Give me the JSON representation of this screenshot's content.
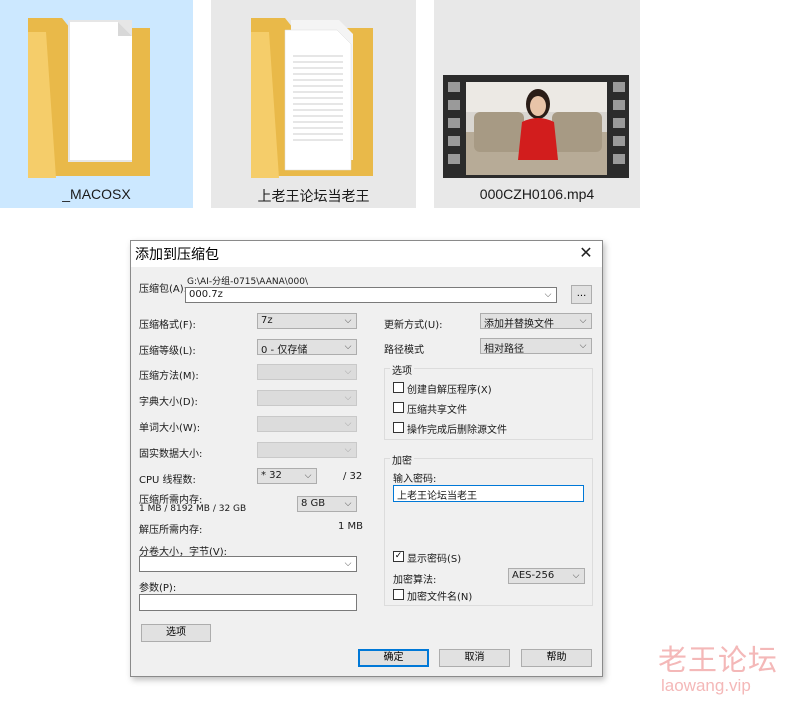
{
  "files": [
    {
      "name": "_MACOSX",
      "icon": "folder-icon",
      "selected": true
    },
    {
      "name": "上老王论坛当老王",
      "icon": "folder-icon",
      "selected": false
    },
    {
      "name": "000CZH0106.mp4",
      "icon": "video-file-icon",
      "selected": false
    }
  ],
  "dialog": {
    "title": "添加到压缩包",
    "close_glyph": "✕",
    "archive": {
      "label": "压缩包(A):",
      "path": "G:\\AI-分组-0715\\AANA\\000\\",
      "value": "000.7z",
      "browse_label": "..."
    },
    "left": {
      "format": {
        "label": "压缩格式(F):",
        "value": "7z"
      },
      "level": {
        "label": "压缩等级(L):",
        "value": "0 - 仅存储"
      },
      "method": {
        "label": "压缩方法(M):",
        "value": ""
      },
      "dict": {
        "label": "字典大小(D):",
        "value": ""
      },
      "word": {
        "label": "单词大小(W):",
        "value": ""
      },
      "solid": {
        "label": "固实数据大小:",
        "value": ""
      },
      "cpu": {
        "label": "CPU 线程数:",
        "value": "* 32",
        "total": "/ 32"
      },
      "mem_comp": {
        "label": "压缩所需内存:",
        "detail": "1 MB / 8192 MB / 32 GB",
        "value": "8 GB"
      },
      "mem_decomp": {
        "label": "解压所需内存:",
        "value": "1 MB"
      },
      "volume": {
        "label": "分卷大小，字节(V):",
        "value": ""
      },
      "params": {
        "label": "参数(P):",
        "value": ""
      },
      "options_button": "选项"
    },
    "right": {
      "update": {
        "label": "更新方式(U):",
        "value": "添加并替换文件"
      },
      "path_mode": {
        "label": "路径模式",
        "value": "相对路径"
      },
      "options_group": {
        "title": "选项",
        "sfx": {
          "label": "创建自解压程序(X)",
          "checked": false
        },
        "shared": {
          "label": "压缩共享文件",
          "checked": false
        },
        "delete": {
          "label": "操作完成后删除源文件",
          "checked": false
        }
      },
      "encryption_group": {
        "title": "加密",
        "password_label": "输入密码:",
        "password_value": "上老王论坛当老王",
        "show_password": {
          "label": "显示密码(S)",
          "checked": true
        },
        "method_label": "加密算法:",
        "method_value": "AES-256",
        "encrypt_names": {
          "label": "加密文件名(N)",
          "checked": false
        }
      }
    },
    "buttons": {
      "ok": "确定",
      "cancel": "取消",
      "help": "帮助"
    },
    "check_glyph": "✓",
    "arrow_glyph": "⌵"
  },
  "watermark": {
    "cn": "老王论坛",
    "en": "laowang.vip"
  }
}
